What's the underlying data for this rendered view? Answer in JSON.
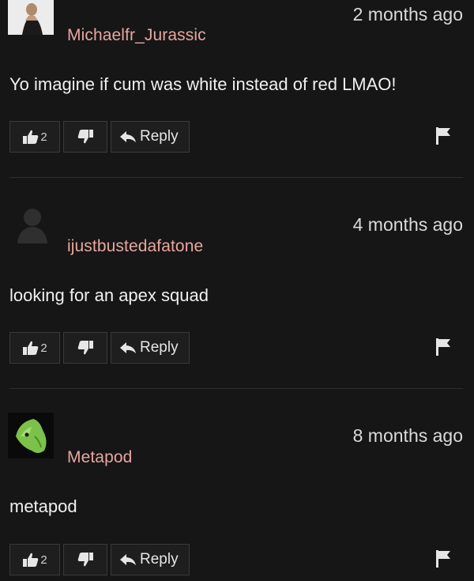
{
  "comments": [
    {
      "username": "Michaelfr_Jurassic",
      "timestamp": "2 months ago",
      "text": "Yo imagine if cum was white instead of red LMAO!",
      "likes": "2",
      "reply_label": "Reply",
      "avatar": "user-photo-avatar"
    },
    {
      "username": "ijustbustedafatone",
      "timestamp": "4 months ago",
      "text": "looking for an apex squad",
      "likes": "2",
      "reply_label": "Reply",
      "avatar": "default-user-avatar"
    },
    {
      "username": "Metapod",
      "timestamp": "8 months ago",
      "text": "metapod",
      "likes": "2",
      "reply_label": "Reply",
      "avatar": "green-cocoon-avatar"
    }
  ],
  "colors": {
    "background": "#161616",
    "username": "#e8a6a0",
    "text": "#f0f0f0",
    "button_bg": "#1e1e1e",
    "button_border": "#3a3a3a"
  },
  "icons": [
    "thumbs-up-icon",
    "thumbs-down-icon",
    "reply-arrow-icon",
    "flag-icon"
  ]
}
